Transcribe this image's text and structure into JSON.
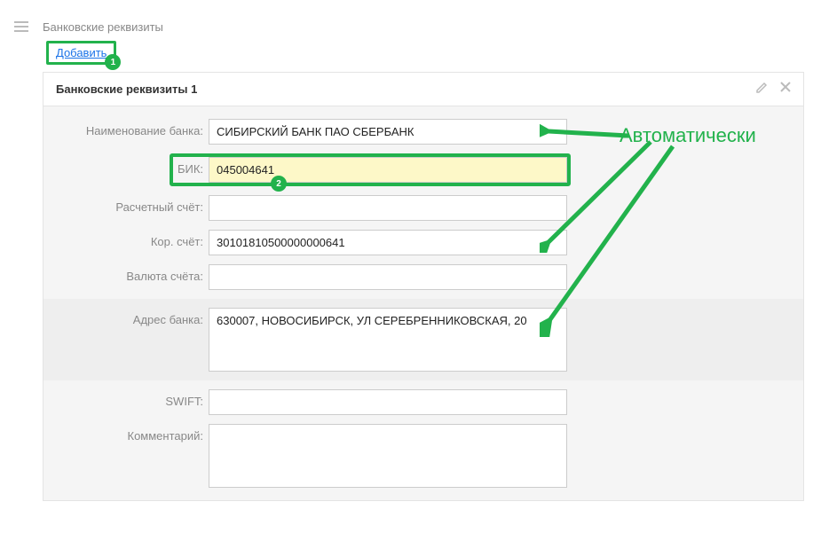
{
  "header": {
    "title": "Банковские реквизиты",
    "add_label": "Добавить",
    "badge1": "1"
  },
  "panel": {
    "title": "Банковские реквизиты 1"
  },
  "labels": {
    "bank_name": "Наименование банка:",
    "bik": "БИК:",
    "acct": "Расчетный счёт:",
    "corr": "Кор. счёт:",
    "currency": "Валюта счёта:",
    "address": "Адрес банка:",
    "swift": "SWIFT:",
    "comment": "Комментарий:"
  },
  "values": {
    "bank_name": "СИБИРСКИЙ БАНК ПАО СБЕРБАНК",
    "bik": "045004641",
    "acct": "",
    "corr": "30101810500000000641",
    "currency": "",
    "address": "630007, НОВОСИБИРСК, УЛ СЕРЕБРЕННИКОВСКАЯ, 20",
    "swift": "",
    "comment": ""
  },
  "badges": {
    "bik": "2"
  },
  "annotation": {
    "auto": "Автоматически"
  }
}
